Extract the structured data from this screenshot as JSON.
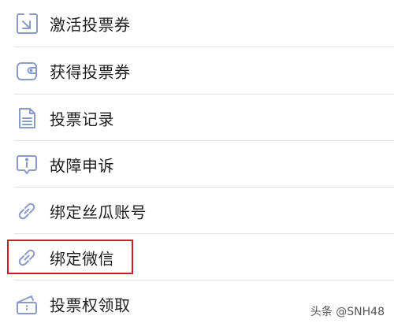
{
  "menu": {
    "items": [
      {
        "label": "激活投票券",
        "icon": "activate-ticket-icon"
      },
      {
        "label": "获得投票券",
        "icon": "wallet-icon"
      },
      {
        "label": "投票记录",
        "icon": "document-icon"
      },
      {
        "label": "故障申诉",
        "icon": "info-bubble-icon"
      },
      {
        "label": "绑定丝瓜账号",
        "icon": "link-icon"
      },
      {
        "label": "绑定微信",
        "icon": "link-icon"
      },
      {
        "label": "投票权领取",
        "icon": "ticket-icon"
      }
    ]
  },
  "highlight": {
    "color": "#c8202a",
    "target": "绑定微信"
  },
  "watermark": {
    "text": "头条 @SNH48"
  },
  "colors": {
    "icon_stroke": "#8a9bc4",
    "text": "#1f1f1f",
    "divider": "#e3e3e3"
  }
}
